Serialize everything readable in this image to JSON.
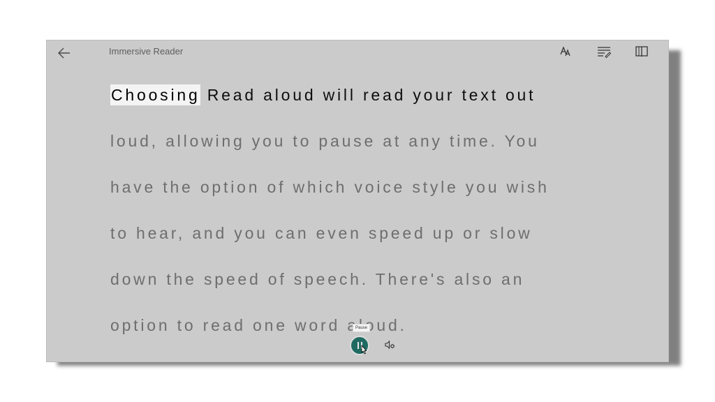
{
  "header": {
    "title": "Immersive Reader"
  },
  "icons": {
    "back": "arrow-left-icon",
    "text_preferences": "text-size-icon",
    "grammar_options": "grammar-lines-icon",
    "reading_preferences": "book-icon",
    "pause": "pause-icon",
    "voice_settings": "voice-settings-icon"
  },
  "content": {
    "highlighted_word": "Choosing",
    "line1_rest": " Read aloud will read your text out",
    "lines": [
      "loud, allowing you to pause at any time. You",
      "have the option of which voice style you wish",
      "to hear, and you can even speed up or slow",
      "down the speed of speech. There's also an",
      "option to read one word aloud."
    ]
  },
  "playback": {
    "tooltip": "Pause"
  },
  "colors": {
    "background": "#cbcbcb",
    "read_text": "#0d0d0d",
    "unread_text": "#6e6e6e",
    "highlight": "#f4f4f4",
    "play_button": "#1f6b62"
  }
}
